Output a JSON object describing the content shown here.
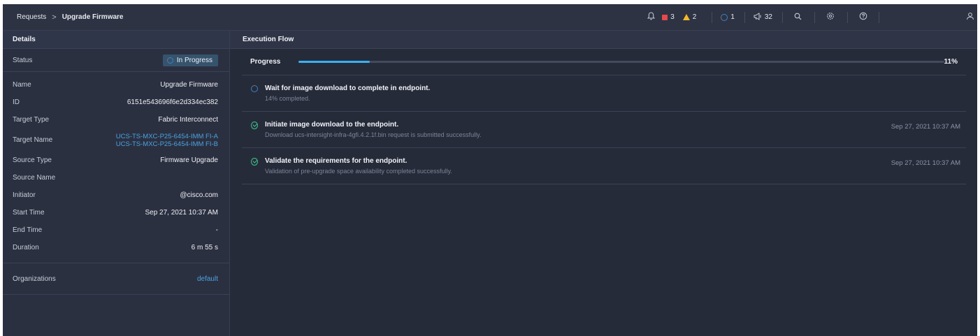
{
  "breadcrumb": {
    "parent": "Requests",
    "separator": ">",
    "current": "Upgrade Firmware"
  },
  "topbar": {
    "critical_count": "3",
    "warning_count": "2",
    "requests_count": "1",
    "announcements_count": "32",
    "icons": [
      "bell-icon",
      "critical-alarm-icon",
      "warning-alarm-icon",
      "requests-spinner-icon",
      "megaphone-icon",
      "search-icon",
      "settings-gear-icon",
      "help-icon",
      "user-icon"
    ]
  },
  "details": {
    "heading": "Details",
    "status_label": "Status",
    "status_value": "In Progress",
    "name_label": "Name",
    "name_value": "Upgrade Firmware",
    "id_label": "ID",
    "id_value": "6151e543696f6e2d334ec382",
    "target_type_label": "Target Type",
    "target_type_value": "Fabric Interconnect",
    "target_name_label": "Target Name",
    "target_name_values": [
      "UCS-TS-MXC-P25-6454-IMM FI-A",
      "UCS-TS-MXC-P25-6454-IMM FI-B"
    ],
    "source_type_label": "Source Type",
    "source_type_value": "Firmware Upgrade",
    "source_name_label": "Source Name",
    "source_name_value": "",
    "initiator_label": "Initiator",
    "initiator_value": "@cisco.com",
    "start_time_label": "Start Time",
    "start_time_value": "Sep 27, 2021 10:37 AM",
    "end_time_label": "End Time",
    "end_time_value": "-",
    "duration_label": "Duration",
    "duration_value": "6 m 55 s",
    "organizations_label": "Organizations",
    "organizations_value": "default"
  },
  "execution": {
    "heading": "Execution Flow",
    "progress_label": "Progress",
    "progress_percent": 11,
    "progress_text": "11%",
    "steps": [
      {
        "status": "in-progress",
        "title": "Wait for image download to complete in endpoint.",
        "description": "14% completed.",
        "time": ""
      },
      {
        "status": "success",
        "title": "Initiate image download to the endpoint.",
        "description": "Download ucs-intersight-infra-4gfi.4.2.1f.bin request is submitted successfully.",
        "time": "Sep 27, 2021 10:37 AM"
      },
      {
        "status": "success",
        "title": "Validate the requirements for the endpoint.",
        "description": "Validation of pre-upgrade space availability completed successfully.",
        "time": "Sep 27, 2021 10:37 AM"
      }
    ]
  },
  "colors": {
    "accent": "#3ab0f0",
    "link": "#4aa3df",
    "success": "#3fc48a",
    "critical": "#e5484d",
    "warning": "#f5b72b"
  }
}
